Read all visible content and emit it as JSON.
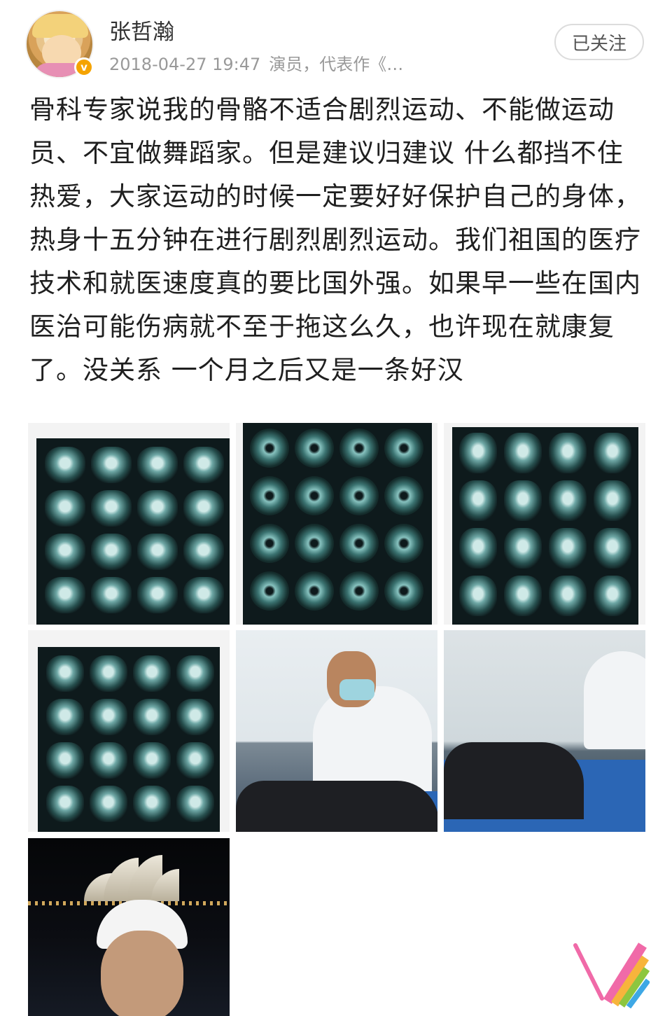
{
  "post": {
    "username": "张哲瀚",
    "timestamp": "2018-04-27 19:47",
    "source": "演员，代表作《…",
    "follow_label": "已关注",
    "verified_badge": "v",
    "text": "骨科专家说我的骨骼不适合剧烈运动、不能做运动员、不宜做舞蹈家。但是建议归建议 什么都挡不住热爱，大家运动的时候一定要好好保护自己的身体，热身十五分钟在进行剧烈剧烈运动。我们祖国的医疗技术和就医速度真的要比国外强。如果早一些在国内医治可能伤病就不至于拖这么久，也许现在就康复了。没关系 一个月之后又是一条好汉"
  },
  "photos": {
    "count": 7,
    "kinds": [
      "mri-film",
      "mri-film-axial",
      "mri-film",
      "mri-film",
      "doctor-treatment",
      "patient-treatment",
      "night-selfie"
    ]
  },
  "icons": {
    "verified": "verified-badge-icon",
    "watermark": "rainbow-logo-icon"
  },
  "colors": {
    "verified_badge": "#f5a300",
    "text_primary": "#1f1f1f",
    "text_meta": "#999999",
    "button_border": "#dcdcdc"
  }
}
